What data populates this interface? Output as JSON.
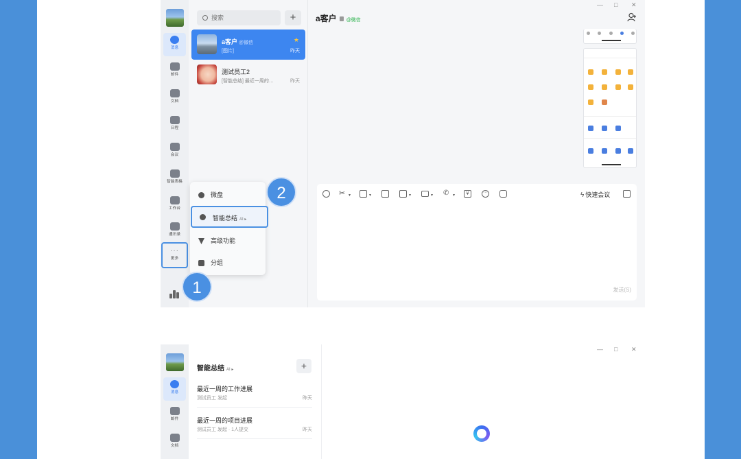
{
  "window1": {
    "nav": [
      {
        "label": "消息",
        "icon": "message-icon",
        "active": true
      },
      {
        "label": "邮件",
        "icon": "mail-icon"
      },
      {
        "label": "文档",
        "icon": "doc-icon"
      },
      {
        "label": "日程",
        "icon": "calendar-icon"
      },
      {
        "label": "会议",
        "icon": "meeting-icon"
      },
      {
        "label": "智能表格",
        "icon": "smart-sheet-icon"
      },
      {
        "label": "工作台",
        "icon": "workbench-icon"
      },
      {
        "label": "通讯录",
        "icon": "contacts-icon"
      },
      {
        "label": "更多",
        "icon": "more-icon"
      }
    ],
    "search_placeholder": "搜索",
    "plus": "+",
    "conversations": [
      {
        "name": "a客户",
        "tag": "@微信",
        "preview": "[图片]",
        "time": "昨天",
        "starred": true
      },
      {
        "name": "测试员工2",
        "preview": "[智能总结] 最近一周的…",
        "time": "昨天"
      }
    ],
    "menu": [
      {
        "label": "微盘",
        "icon": "drive-icon"
      },
      {
        "label": "智能总结",
        "ai": "AI ▸",
        "icon": "ai-summary-icon",
        "highlighted": true
      },
      {
        "label": "高级功能",
        "icon": "advanced-icon"
      },
      {
        "label": "分组",
        "icon": "tag-icon"
      }
    ],
    "badge1": "1",
    "badge2": "2",
    "chat": {
      "title": "a客户",
      "tag": "@微信",
      "quick_meeting": "快速会议",
      "send": "发送(S)"
    },
    "window_controls": [
      "—",
      "□",
      "✕"
    ]
  },
  "window2": {
    "nav": [
      {
        "label": "消息",
        "active": true
      },
      {
        "label": "邮件"
      },
      {
        "label": "文档"
      }
    ],
    "title": "智能总结",
    "ai": "AI ▸",
    "plus": "+",
    "items": [
      {
        "title": "最近一周的工作进展",
        "sub": "测试员工 发起",
        "time": "昨天"
      },
      {
        "title": "最近一周的项目进展",
        "sub": "测试员工 发起 · 1人提交",
        "time": "昨天"
      }
    ],
    "window_controls": [
      "—",
      "□",
      "✕"
    ]
  },
  "colors": {
    "accent": "#3d86f0",
    "background": "#4a90d9",
    "highlight_border": "#4a90e2"
  }
}
